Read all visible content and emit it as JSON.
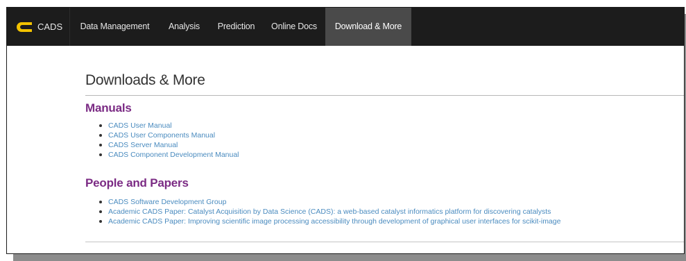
{
  "navbar": {
    "brand": "CADS",
    "items": [
      {
        "label": "Data Management",
        "active": false
      },
      {
        "label": "Analysis",
        "active": false
      },
      {
        "label": "Prediction",
        "active": false
      },
      {
        "label": "Online Docs",
        "active": false
      },
      {
        "label": "Download & More",
        "active": true
      }
    ]
  },
  "page": {
    "title": "Downloads & More"
  },
  "sections": {
    "manuals": {
      "heading": "Manuals",
      "links": [
        "CADS User Manual",
        "CADS User Components Manual",
        "CADS Server Manual",
        "CADS Component Development Manual"
      ]
    },
    "people_papers": {
      "heading": "People and Papers",
      "links": [
        "CADS Software Development Group",
        "Academic CADS Paper: Catalyst Acquisition by Data Science (CADS): a web-based catalyst informatics platform for discovering catalysts",
        "Academic CADS Paper: Improving scientific image processing accessibility through development of graphical user interfaces for scikit-image"
      ]
    }
  },
  "colors": {
    "navbar_bg": "#1c1c1c",
    "nav_active_bg": "#4a4a4a",
    "brand_logo": "#f2c200",
    "section_heading": "#7b2b84",
    "link": "#4a8bbf"
  }
}
